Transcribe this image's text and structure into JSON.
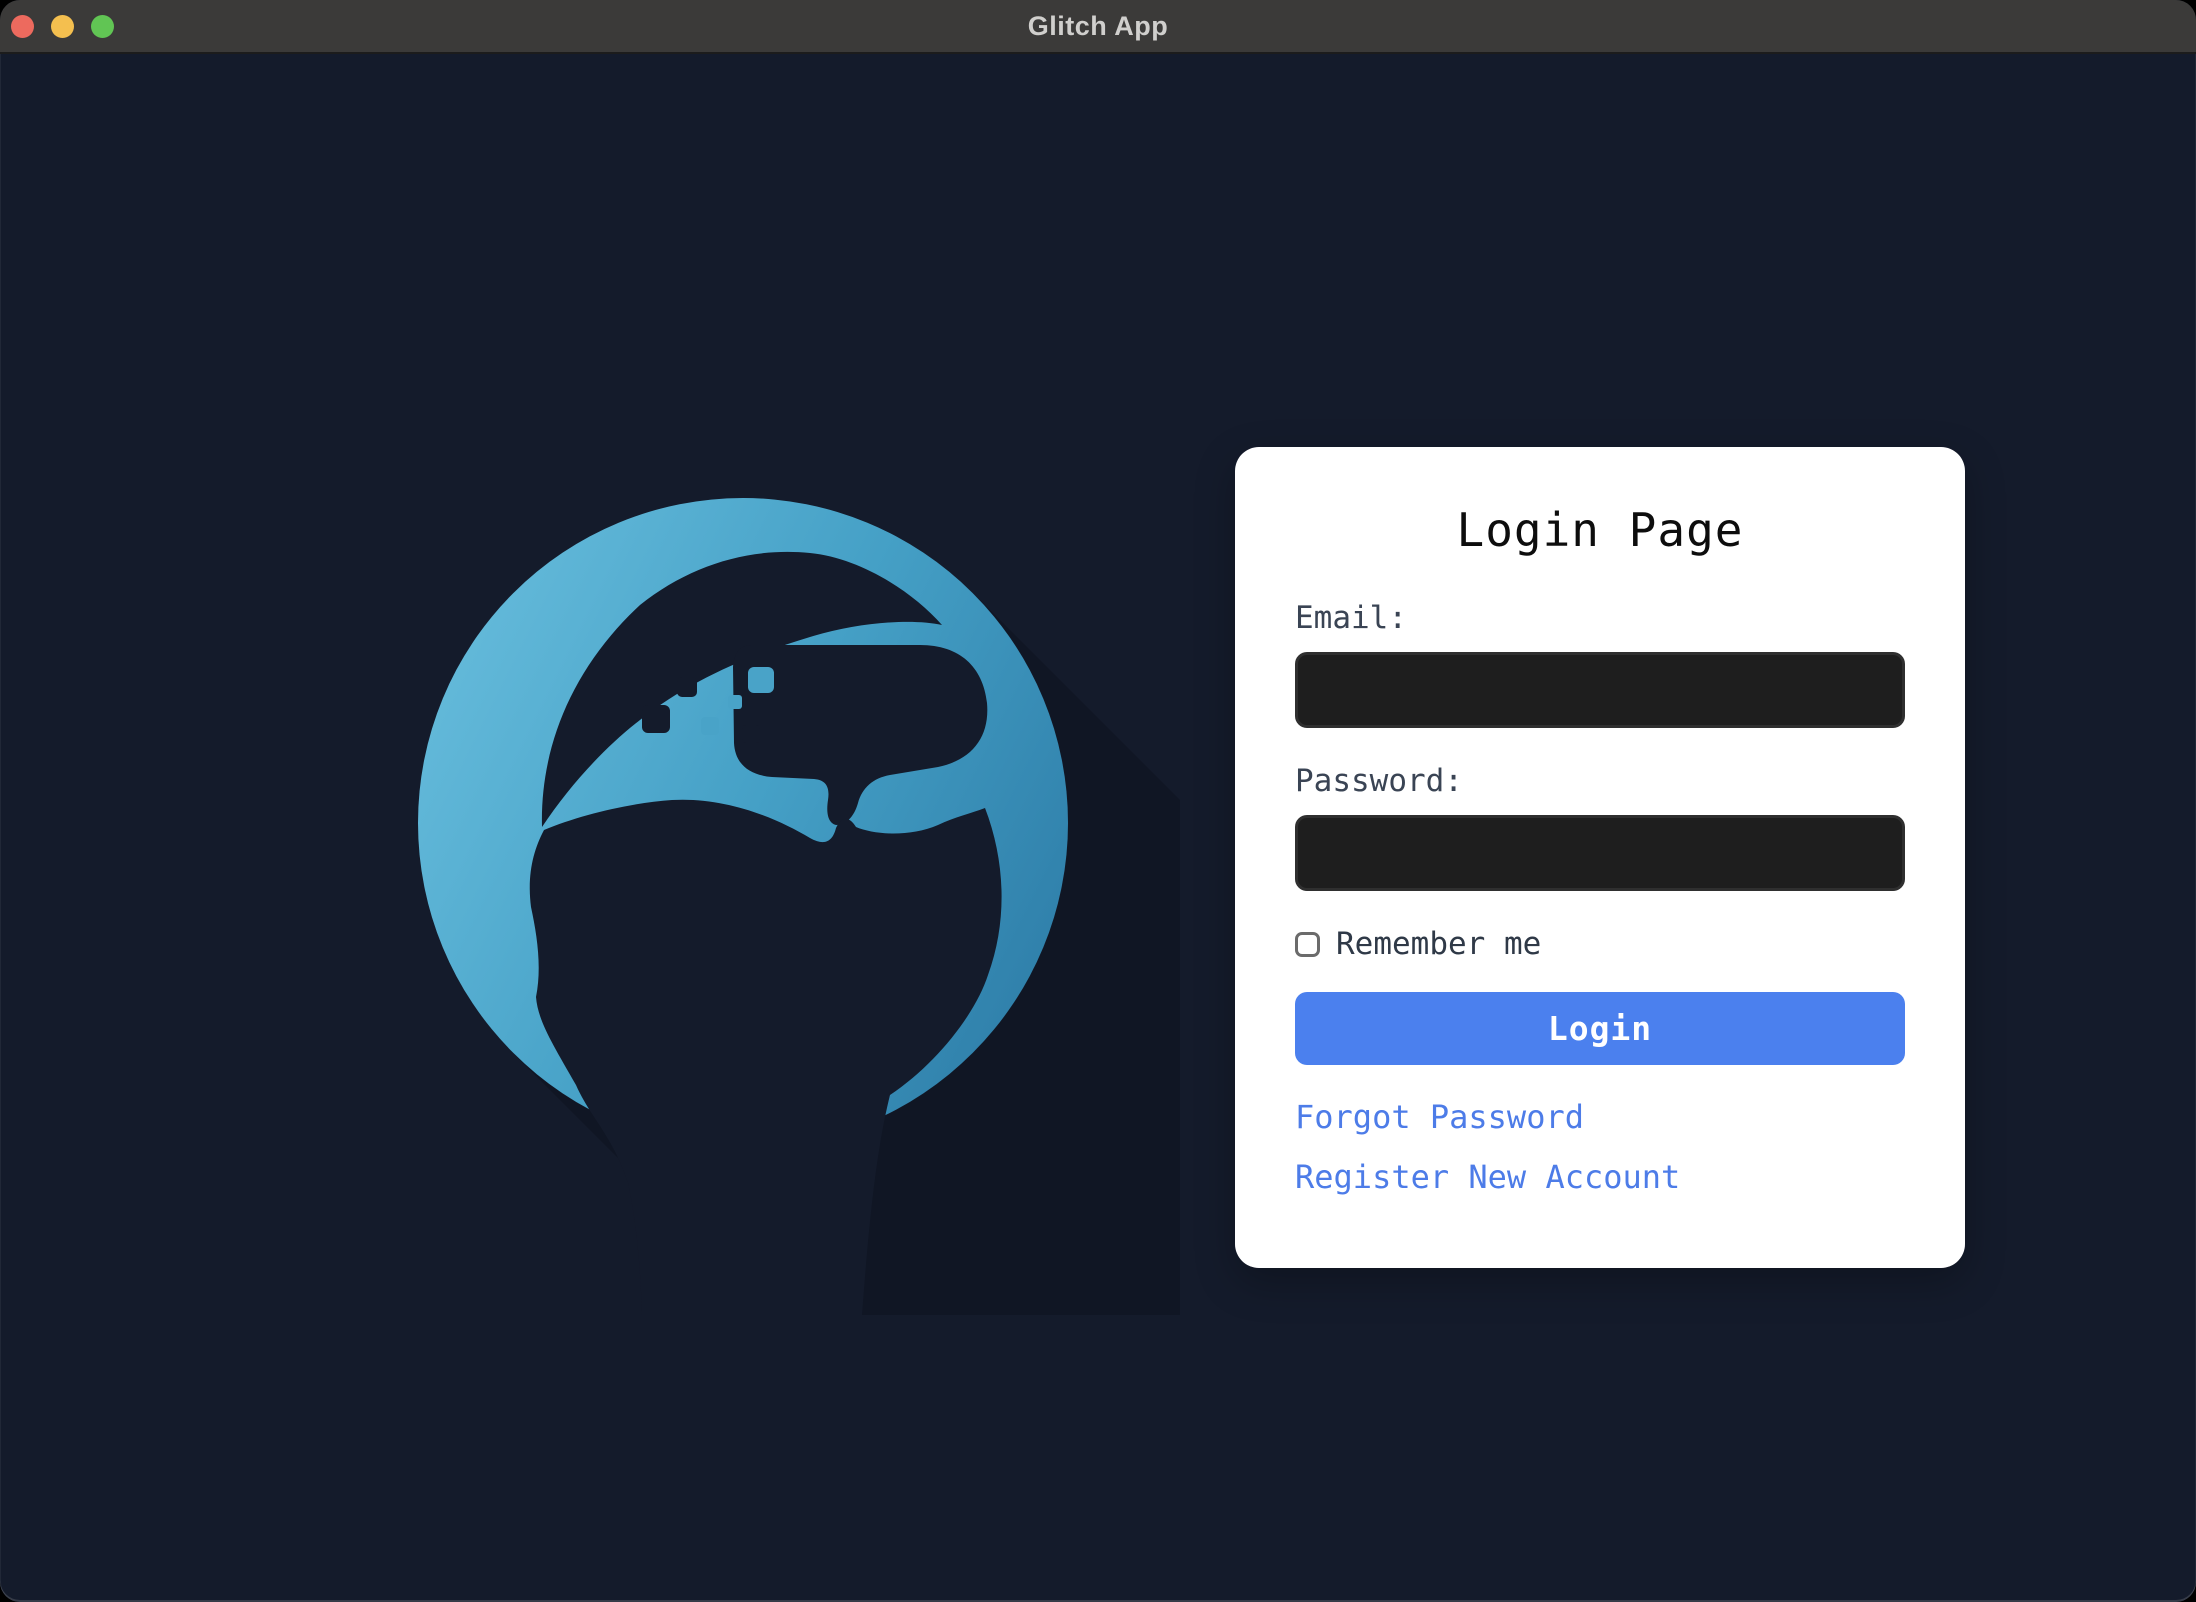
{
  "window": {
    "title": "Glitch App",
    "traffic_lights": [
      "close",
      "minimize",
      "zoom"
    ]
  },
  "card": {
    "title": "Login Page",
    "email_label": "Email:",
    "email_value": "",
    "password_label": "Password:",
    "password_value": "",
    "remember_label": "Remember me",
    "remember_checked": false,
    "login_button": "Login",
    "links": [
      {
        "label": "Forgot Password"
      },
      {
        "label": "Register New Account"
      }
    ]
  },
  "logo": {
    "name": "vr-headset-head-logo",
    "description": "circular badge of a head wearing VR goggles with pixel-dissolve effect and long diagonal shadow"
  },
  "colors": {
    "background": "#141b2b",
    "titlebar": "#3b3a39",
    "titlebar_text": "#d0cfcd",
    "traffic_red": "#ed6a5e",
    "traffic_yellow": "#f4bf4f",
    "traffic_green": "#61c554",
    "card_background": "#ffffff",
    "input_background": "#1e1e1e",
    "button_blue": "#4b80ee",
    "link_blue": "#4d7ce8",
    "label_text": "#3a4454",
    "logo_blue_light": "#5db8da",
    "logo_blue_dark": "#2e7ea9"
  }
}
